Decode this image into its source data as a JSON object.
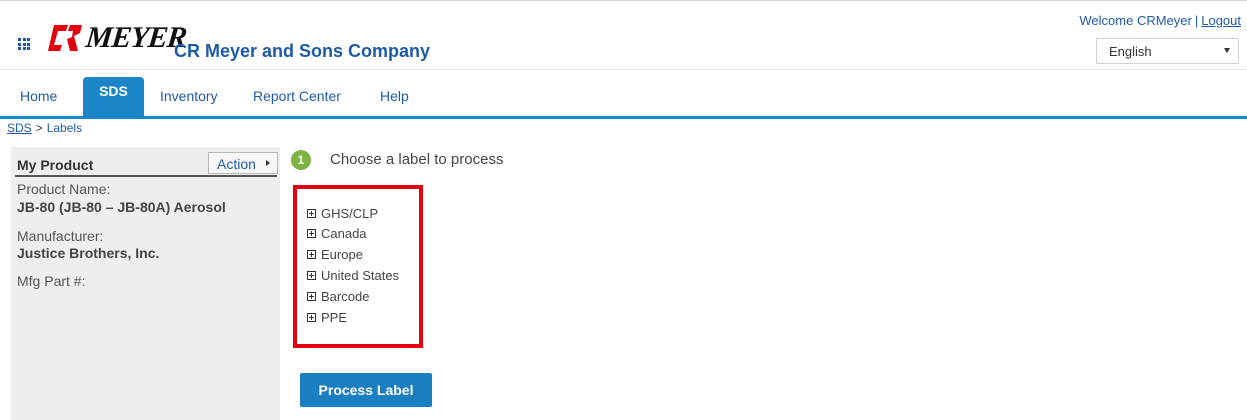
{
  "header": {
    "logo_text": "MEYER",
    "logo_mark": "CR",
    "company_name": "CR Meyer and Sons Company",
    "welcome_text": "Welcome CRMeyer",
    "separator": "|",
    "logout_label": "Logout",
    "language": "English",
    "apps_icon": "grid-icon",
    "colors": {
      "brand_blue": "#1f5aa6",
      "logo_red": "#e3000f"
    }
  },
  "nav": {
    "items": [
      {
        "label": "Home",
        "active": false
      },
      {
        "label": "SDS",
        "active": true
      },
      {
        "label": "Inventory",
        "active": false
      },
      {
        "label": "Report Center",
        "active": false
      },
      {
        "label": "Help",
        "active": false
      }
    ],
    "active_color": "#1a86c8"
  },
  "breadcrumb": {
    "root": "SDS",
    "separator": ">",
    "current": "Labels"
  },
  "sidebar": {
    "title": "My Product",
    "action_label": "Action",
    "product_name_label": "Product Name:",
    "product_name_value": "JB-80 (JB-80 – JB-80A) Aerosol",
    "manufacturer_label": "Manufacturer:",
    "manufacturer_value": "Justice Brothers, Inc.",
    "mfg_part_label": "Mfg Part #:"
  },
  "main": {
    "step_number": "1",
    "step_text": "Choose a label to process",
    "label_tree": [
      "GHS/CLP",
      "Canada",
      "Europe",
      "United States",
      "Barcode",
      "PPE"
    ],
    "highlight_color": "#e3000f",
    "process_button": "Process Label"
  }
}
